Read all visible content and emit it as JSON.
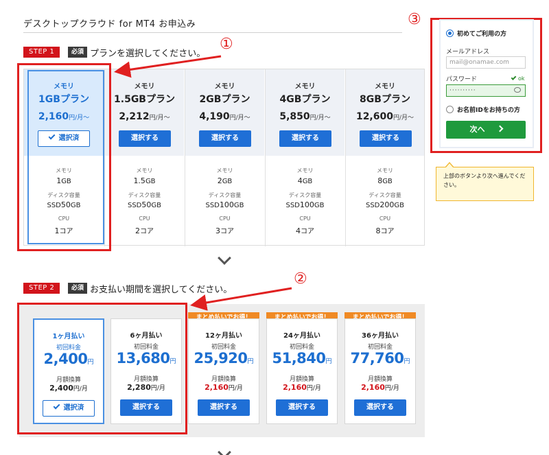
{
  "page": {
    "title": "デスクトップクラウド for MT4 お申込み"
  },
  "step1": {
    "badge": "STEP 1",
    "required": "必須",
    "title": "プランを選択してください。"
  },
  "step2": {
    "badge": "STEP 2",
    "required": "必須",
    "title": "お支払い期間を選択してください。"
  },
  "spec_labels": {
    "memory": "メモリ",
    "disk": "ディスク容量",
    "cpu": "CPU"
  },
  "plans": [
    {
      "mem_label": "メモリ",
      "name": "1GBプラン",
      "price": "2,160",
      "unit": "円/月〜",
      "button": "選択済",
      "selected": true,
      "memory": "1",
      "memory_unit": "GB",
      "disk_prefix": "SSD",
      "disk": "50",
      "disk_unit": "GB",
      "cpu": "1",
      "cpu_unit": "コア"
    },
    {
      "mem_label": "メモリ",
      "name": "1.5GBプラン",
      "price": "2,212",
      "unit": "円/月〜",
      "button": "選択する",
      "selected": false,
      "memory": "1.5",
      "memory_unit": "GB",
      "disk_prefix": "SSD",
      "disk": "50",
      "disk_unit": "GB",
      "cpu": "2",
      "cpu_unit": "コア"
    },
    {
      "mem_label": "メモリ",
      "name": "2GBプラン",
      "price": "4,190",
      "unit": "円/月〜",
      "button": "選択する",
      "selected": false,
      "memory": "2",
      "memory_unit": "GB",
      "disk_prefix": "SSD",
      "disk": "100",
      "disk_unit": "GB",
      "cpu": "3",
      "cpu_unit": "コア"
    },
    {
      "mem_label": "メモリ",
      "name": "4GBプラン",
      "price": "5,850",
      "unit": "円/月〜",
      "button": "選択する",
      "selected": false,
      "memory": "4",
      "memory_unit": "GB",
      "disk_prefix": "SSD",
      "disk": "100",
      "disk_unit": "GB",
      "cpu": "4",
      "cpu_unit": "コア"
    },
    {
      "mem_label": "メモリ",
      "name": "8GBプラン",
      "price": "12,600",
      "unit": "円/月〜",
      "button": "選択する",
      "selected": false,
      "memory": "8",
      "memory_unit": "GB",
      "disk_prefix": "SSD",
      "disk": "200",
      "disk_unit": "GB",
      "cpu": "8",
      "cpu_unit": "コア"
    }
  ],
  "payment_labels": {
    "initial": "初回料金",
    "monthly": "月額換算",
    "yen": "円",
    "per_month": "円/月"
  },
  "payments": [
    {
      "name": "1ヶ月払い",
      "initial": "2,400",
      "monthly": "2,400",
      "button": "選択済",
      "selected": true,
      "promo": ""
    },
    {
      "name": "6ヶ月払い",
      "initial": "13,680",
      "monthly": "2,280",
      "button": "選択する",
      "selected": false,
      "promo": ""
    },
    {
      "name": "12ヶ月払い",
      "initial": "25,920",
      "monthly": "2,160",
      "button": "選択する",
      "selected": false,
      "promo": "まとめ払いでお得！"
    },
    {
      "name": "24ヶ月払い",
      "initial": "51,840",
      "monthly": "2,160",
      "button": "選択する",
      "selected": false,
      "promo": "まとめ払いでお得！"
    },
    {
      "name": "36ヶ月払い",
      "initial": "77,760",
      "monthly": "2,160",
      "button": "選択する",
      "selected": false,
      "promo": "まとめ払いでお得！"
    }
  ],
  "login": {
    "first_time": "初めてご利用の方",
    "email_label": "メールアドレス",
    "email_placeholder": "mail@onamae.com",
    "password_label": "パスワード",
    "password_ok": "ok",
    "password_mask": "··········",
    "has_id": "お名前IDをお持ちの方",
    "next": "次へ"
  },
  "tooltip": {
    "text": "上部のボタンより次へ進んでください。"
  },
  "annotations": {
    "one": "①",
    "two": "②",
    "three": "③"
  },
  "colors": {
    "accent": "#1f6fd6",
    "step_red": "#d2141b",
    "annotation_red": "#e02020",
    "promo_orange": "#f08a24",
    "next_green": "#1f9a3d"
  }
}
